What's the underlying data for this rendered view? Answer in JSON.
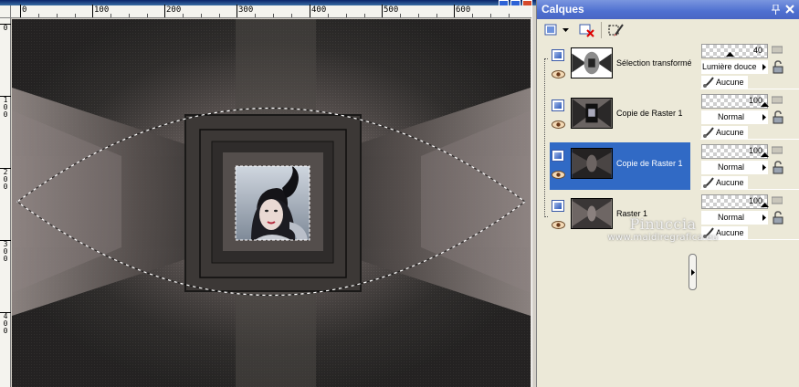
{
  "editor": {
    "ruler_h_labels": [
      "0",
      "100",
      "200",
      "300",
      "400",
      "500",
      "600"
    ],
    "ruler_v_labels": [
      "0",
      "1\n0\n0",
      "2\n0\n0",
      "3\n0\n0",
      "4\n0\n0"
    ]
  },
  "palette": {
    "title": "Calques",
    "layers": [
      {
        "name": "Sélection transformée",
        "opacity": 40,
        "blend": "Lumière douce",
        "mask": "Aucune",
        "selected": false
      },
      {
        "name": "Copie de Raster 1",
        "opacity": 100,
        "blend": "Normal",
        "mask": "Aucune",
        "selected": false
      },
      {
        "name": "Copie de Raster 1",
        "opacity": 100,
        "blend": "Normal",
        "mask": "Aucune",
        "selected": true
      },
      {
        "name": "Raster 1",
        "opacity": 100,
        "blend": "Normal",
        "mask": "Aucune",
        "selected": false
      }
    ]
  },
  "watermark": {
    "brand": "Pinuccia",
    "site": "www.maidiregrafica.eu"
  },
  "colors": {
    "title_bar": "#4e6fd0",
    "selection": "#316ac5",
    "canvas_dark": "#2a2828"
  }
}
